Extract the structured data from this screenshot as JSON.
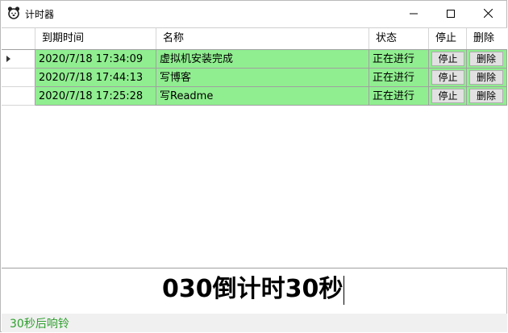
{
  "window": {
    "title": "计时器",
    "controls": {
      "minimize": "minimize",
      "maximize": "maximize",
      "close": "close"
    }
  },
  "grid": {
    "columns": [
      "到期时间",
      "名称",
      "状态",
      "停止",
      "删除"
    ],
    "rows": [
      {
        "expire": "2020/7/18 17:34:09",
        "name": "虚拟机安装完成",
        "status": "正在进行",
        "stop": "停止",
        "delete": "删除",
        "current": true
      },
      {
        "expire": "2020/7/18 17:44:13",
        "name": "写博客",
        "status": "正在进行",
        "stop": "停止",
        "delete": "删除",
        "current": false
      },
      {
        "expire": "2020/7/18 17:25:28",
        "name": "写Readme",
        "status": "正在进行",
        "stop": "停止",
        "delete": "删除",
        "current": false
      }
    ],
    "row_color": "#90ee90"
  },
  "input": {
    "value": "030倒计时30秒"
  },
  "status_bar": {
    "text": "30秒后响铃",
    "color": "#2e9f2e"
  }
}
